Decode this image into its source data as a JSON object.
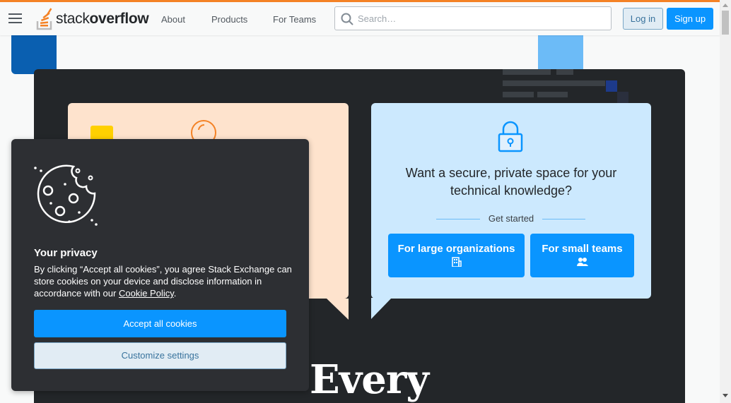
{
  "header": {
    "logo_prefix": "stack",
    "logo_suffix": "overflow",
    "nav": [
      {
        "label": "About"
      },
      {
        "label": "Products"
      },
      {
        "label": "For Teams"
      }
    ],
    "search_placeholder": "Search…",
    "login_label": "Log in",
    "signup_label": "Sign up"
  },
  "teams_card": {
    "heading": "Want a secure, private space for your technical knowledge?",
    "get_started": "Get started",
    "large_org_label": "For large organizations",
    "small_teams_label": "For small teams",
    "icons": [
      "lock-icon",
      "building-icon",
      "users-icon"
    ]
  },
  "cookie": {
    "title": "Your privacy",
    "body": "By clicking “Accept all cookies”, you agree Stack Exchange can store cookies on your device and disclose information in accordance with our",
    "policy_link": "Cookie Policy",
    "body_end": ".",
    "accept_label": "Accept all cookies",
    "customize_label": "Customize settings",
    "icon": "cookie-icon"
  },
  "hero": {
    "headline_fragment": "Every"
  },
  "colors": {
    "accent": "#f48225",
    "primary_button": "#0a95ff",
    "secondary_button_bg": "#e1ecf4",
    "hero_bg": "#232629",
    "peach_card": "#fee3cd",
    "blue_card": "#cce9fe",
    "cookie_bg": "#2d2f33"
  }
}
